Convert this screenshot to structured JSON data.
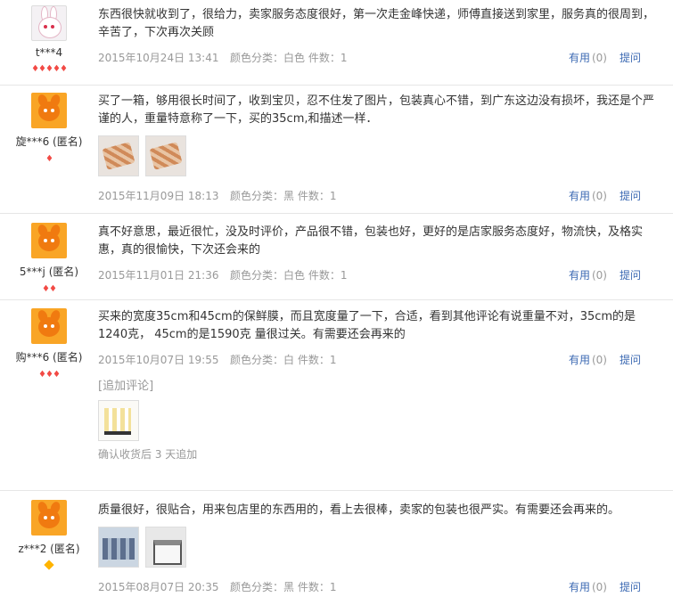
{
  "reviews": [
    {
      "user": "t***4",
      "avatar": "rabbit-avatar",
      "level_icon": "heart",
      "level_count": 5,
      "text": "东西很快就收到了，很给力，卖家服务态度很好，第一次走金峰快递，师傅直接送到家里，服务真的很周到，辛苦了，下次再次关顾",
      "date": "2015年10月24日 13:41",
      "sku": "颜色分类：白色  件数：1",
      "photos": []
    },
    {
      "user": "旋***6 (匿名)",
      "avatar": "taobao-avatar",
      "level_icon": "heart",
      "level_count": 1,
      "text": "买了一箱，够用很长时间了，收到宝贝，忍不住发了图片，包装真心不错，到广东这边没有损坏，我还是个严谨的人，重量特意称了一下，买的35cm,和描述一样．",
      "date": "2015年11月09日 18:13",
      "sku": "颜色分类：黑  件数：1",
      "photos": [
        "package-photo",
        "package-photo"
      ]
    },
    {
      "user": "5***j (匿名)",
      "avatar": "taobao-avatar",
      "level_icon": "heart",
      "level_count": 2,
      "text": "真不好意思，最近很忙，没及时评价，产品很不错，包装也好，更好的是店家服务态度好，物流快，及格实惠，真的很愉快，下次还会来的",
      "date": "2015年11月01日 21:36",
      "sku": "颜色分类：白色  件数：1",
      "photos": []
    },
    {
      "user": "购***6 (匿名)",
      "avatar": "taobao-avatar",
      "level_icon": "heart",
      "level_count": 3,
      "text": "买来的宽度35cm和45cm的保鲜膜，而且宽度量了一下，合适，看到其他评论有说重量不对，35cm的是1240克， 45cm的是1590克 量很过关。有需要还会再来的",
      "date": "2015年10月07日 19:55",
      "sku": "颜色分类：白  件数：1",
      "photos": [],
      "append": {
        "title": "[追加评论]",
        "photos": [
          "wrap-photo"
        ],
        "note": "确认收货后 3 天追加"
      }
    },
    {
      "user": "z***2 (匿名)",
      "avatar": "taobao-avatar",
      "level_icon": "diamond",
      "level_count": 1,
      "text": "质量很好，很贴合，用来包店里的东西用的，看上去很棒，卖家的包装也很严实。有需要还会再来的。",
      "date": "2015年08月07日 20:35",
      "sku": "颜色分类：黑  件数：1",
      "photos": [
        "shelf-photo",
        "machine-photo"
      ]
    }
  ],
  "actions": {
    "useful_label": "有用",
    "useful_count": "(0)",
    "ask_label": "提问"
  }
}
